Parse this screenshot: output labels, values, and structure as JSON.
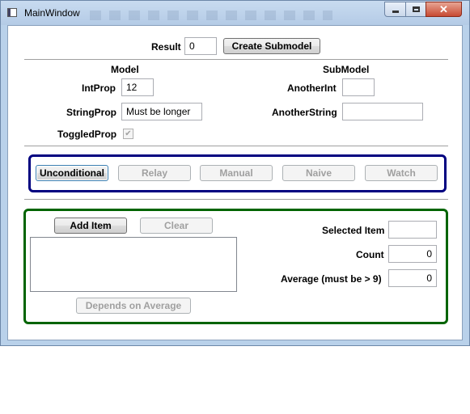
{
  "window": {
    "title": "MainWindow"
  },
  "top": {
    "result_label": "Result",
    "result_value": "0",
    "create_submodel_label": "Create Submodel"
  },
  "model": {
    "heading": "Model",
    "int_prop_label": "IntProp",
    "int_prop_value": "12",
    "string_prop_label": "StringProp",
    "string_prop_value": "Must be longer",
    "toggled_prop_label": "ToggledProp",
    "toggled_checked": true
  },
  "submodel": {
    "heading": "SubModel",
    "another_int_label": "AnotherInt",
    "another_int_value": "",
    "another_string_label": "AnotherString",
    "another_string_value": ""
  },
  "commands": {
    "unconditional": "Unconditional",
    "relay": "Relay",
    "manual": "Manual",
    "naive": "Naive",
    "watch": "Watch"
  },
  "items": {
    "add_item": "Add Item",
    "clear": "Clear",
    "depends_on_average": "Depends on Average",
    "selected_item_label": "Selected Item",
    "selected_item_value": "",
    "count_label": "Count",
    "count_value": "0",
    "average_label": "Average (must be > 9)",
    "average_value": "0"
  },
  "colors": {
    "command_border": "#000080",
    "items_border": "#006400"
  }
}
